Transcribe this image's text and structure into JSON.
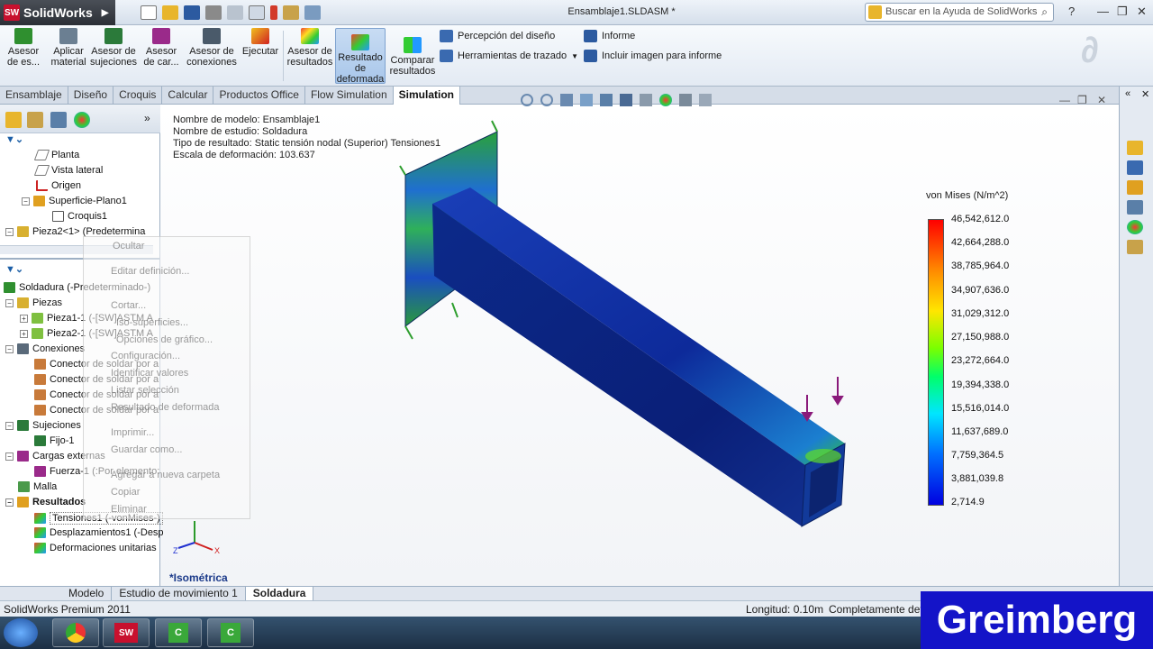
{
  "app": {
    "logo_text": "SolidWorks",
    "doc_title": "Ensamblaje1.SLDASM *",
    "search_placeholder": "Buscar en la Ayuda de SolidWorks"
  },
  "ribbon": {
    "buttons": [
      {
        "label": "Asesor de es..."
      },
      {
        "label": "Aplicar material"
      },
      {
        "label": "Asesor de sujeciones"
      },
      {
        "label": "Asesor de car..."
      },
      {
        "label": "Asesor de conexiones"
      },
      {
        "label": "Ejecutar"
      },
      {
        "label": "Asesor de resultados"
      },
      {
        "label": "Resultado de deformada"
      },
      {
        "label": "Comparar resultados"
      }
    ],
    "small": [
      "Percepción del diseño",
      "Herramientas de trazado",
      "Informe",
      "Incluir imagen para informe"
    ]
  },
  "tabs": [
    "Ensamblaje",
    "Diseño",
    "Croquis",
    "Calcular",
    "Productos Office",
    "Flow Simulation",
    "Simulation"
  ],
  "tree_top": [
    "Planta",
    "Vista lateral",
    "Origen",
    "Superficie-Plano1",
    "Croquis1",
    "Pieza2<1> (Predetermina"
  ],
  "tree_study": {
    "root": "Soldadura (-Predeterminado-)",
    "piezas": "Piezas",
    "pieza1": "Pieza1-1 (-[SW]ASTM A",
    "pieza2": "Pieza2-1 (-[SW]ASTM A",
    "conexiones": "Conexiones",
    "conectores": [
      "Conector de soldar por a",
      "Conector de soldar por a",
      "Conector de soldar por a",
      "Conector de soldar por a"
    ],
    "sujeciones": "Sujeciones",
    "fijo": "Fijo-1",
    "cargas": "Cargas externas",
    "fuerza": "Fuerza-1 (:Por elemento:",
    "malla": "Malla",
    "resultados": "Resultados",
    "tensiones": "Tensiones1 (-vonMises-)",
    "desplazamientos": "Desplazamientos1 (-Desp",
    "deformaciones": "Deformaciones unitarias"
  },
  "context_menu": [
    "Ocultar",
    "Editar definición...",
    "Cortar...",
    "Configuración...",
    "Identificar valores",
    "Listar selección",
    "Resultado de deformada",
    "Imprimir...",
    "Guardar como...",
    "Agregar a nueva carpeta",
    "Copiar",
    "Eliminar"
  ],
  "context_menu_extra": [
    "Iso-superficies...",
    "Opciones de gráfico..."
  ],
  "viewport": {
    "info": [
      "Nombre de modelo: Ensamblaje1",
      "Nombre de estudio: Soldadura",
      "Tipo de resultado: Static tensión nodal (Superior) Tensiones1",
      "Escala de deformación: 103.637"
    ],
    "view_label": "*Isométrica"
  },
  "legend": {
    "title": "von Mises (N/m^2)",
    "values": [
      "46,542,612.0",
      "42,664,288.0",
      "38,785,964.0",
      "34,907,636.0",
      "31,029,312.0",
      "27,150,988.0",
      "23,272,664.0",
      "19,394,338.0",
      "15,516,014.0",
      "11,637,689.0",
      "7,759,364.5",
      "3,881,039.8",
      "2,714.9"
    ]
  },
  "bottom_tabs": [
    "Modelo",
    "Estudio de movimiento 1",
    "Soldadura"
  ],
  "status": {
    "product": "SolidWorks Premium 2011",
    "length": "Longitud: 0.10m",
    "state": "Completamente defi"
  },
  "brand": "Greimberg",
  "colors": {
    "accent": "#1b5ea6",
    "brand_bg": "#1414c8"
  }
}
